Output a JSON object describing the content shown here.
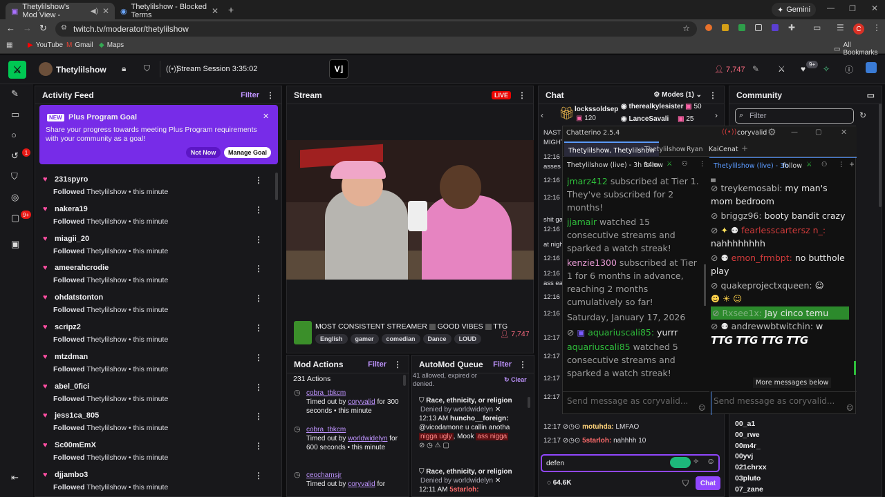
{
  "browser": {
    "tabs": [
      {
        "title": "Thetylilshow's Mod View -",
        "active": true
      },
      {
        "title": "Thetylilshow - Blocked Terms",
        "active": false
      }
    ],
    "url": "twitch.tv/moderator/thetylilshow",
    "gemini": "Gemini",
    "bookmarks": [
      "YouTube",
      "Gmail",
      "Maps"
    ],
    "all_bookmarks": "All Bookmarks",
    "profile_initial": "C"
  },
  "topnav": {
    "channel": "Thetylilshow",
    "session": "Stream Session 3:35:02",
    "viewers": "7,747",
    "notif_badge": "9+"
  },
  "rail": {
    "badge1": "1",
    "badge2": "9+"
  },
  "activity": {
    "title": "Activity Feed",
    "filter": "Filter",
    "promo": {
      "badge": "NEW",
      "title": "Plus Program Goal",
      "text": "Share your progress towards meeting Plus Program requirements with your community as a goal!",
      "not_now": "Not Now",
      "manage": "Manage Goal"
    },
    "items": [
      {
        "name": "231spyro",
        "action": "Followed",
        "target": "Thetylilshow",
        "time": "this minute"
      },
      {
        "name": "nakera19",
        "action": "Followed",
        "target": "Thetylilshow",
        "time": "this minute"
      },
      {
        "name": "miagii_20",
        "action": "Followed",
        "target": "Thetylilshow",
        "time": "this minute"
      },
      {
        "name": "ameerahcrodie",
        "action": "Followed",
        "target": "Thetylilshow",
        "time": "this minute"
      },
      {
        "name": "ohdatstonton",
        "action": "Followed",
        "target": "Thetylilshow",
        "time": "this minute"
      },
      {
        "name": "scripz2",
        "action": "Followed",
        "target": "Thetylilshow",
        "time": "this minute"
      },
      {
        "name": "mtzdman",
        "action": "Followed",
        "target": "Thetylilshow",
        "time": "this minute"
      },
      {
        "name": "abel_0fici",
        "action": "Followed",
        "target": "Thetylilshow",
        "time": "this minute"
      },
      {
        "name": "jess1ca_805",
        "action": "Followed",
        "target": "Thetylilshow",
        "time": "this minute"
      },
      {
        "name": "Sc00mEmX",
        "action": "Followed",
        "target": "Thetylilshow",
        "time": "this minute"
      },
      {
        "name": "djjambo3",
        "action": "Followed",
        "target": "Thetylilshow",
        "time": "this minute"
      }
    ]
  },
  "stream": {
    "title": "Stream",
    "live": "LIVE",
    "stream_title": "MOST CONSISTENT STREAMER",
    "good_vibes": "GOOD VIBES",
    "ttg": "TTG",
    "viewers": "7,747",
    "tags": [
      "English",
      "gamer",
      "comedian",
      "Dance",
      "LOUD"
    ]
  },
  "modactions": {
    "title": "Mod Actions",
    "filter": "Filter",
    "count": "231 Actions",
    "items": [
      {
        "user": "cobra_tbkcm",
        "text": "Timed out by",
        "mod": "coryvalid",
        "dur": "for 300 seconds",
        "time": "this minute"
      },
      {
        "user": "cobra_tbkcm",
        "text": "Timed out by",
        "mod": "worldwidelyn",
        "dur": "for 600 seconds",
        "time": "this minute"
      },
      {
        "user": "ceochamsjr",
        "text": "Timed out by",
        "mod": "coryvalid",
        "dur": "for"
      }
    ]
  },
  "automod": {
    "title": "AutoMod Queue",
    "filter": "Filter",
    "status": "41 allowed, expired or denied.",
    "clear": "Clear",
    "items": [
      {
        "category": "Race, ethnicity, or religion",
        "denied": "Denied by worldwidelyn",
        "time": "12:13 AM",
        "user": "huncho__foreign:",
        "msg1": "@vicodamone u callin anotha",
        "flag1": "nigga ugly",
        "msg2": ", Mook",
        "flag2": "ass nigga"
      },
      {
        "category": "Race, ethnicity, or religion",
        "denied": "Denied by worldwidelyn",
        "time": "12:11 AM",
        "user": "5starloh:"
      }
    ]
  },
  "chat": {
    "title": "Chat",
    "modes": "Modes (1)",
    "gifters": [
      {
        "name": "lockssoldsep",
        "count": "120"
      },
      {
        "name": "therealkylesister",
        "count": "50"
      },
      {
        "name": "LanceSavali",
        "count": "25"
      }
    ],
    "behind_lines": [
      {
        "time": "",
        "text": "NAST"
      },
      {
        "time": "",
        "text": "MIGHT"
      },
      {
        "time": "12:16",
        "text": ""
      },
      {
        "time": "",
        "text": "asses"
      },
      {
        "time": "12:16",
        "text": ""
      },
      {
        "time": "12:16",
        "text": ""
      },
      {
        "time": "",
        "text": "shit ga"
      },
      {
        "time": "12:16",
        "text": ""
      },
      {
        "time": "",
        "text": "at nigh"
      },
      {
        "time": "12:16",
        "text": ""
      },
      {
        "time": "12:16",
        "text": ""
      },
      {
        "time": "",
        "text": "ass ea"
      },
      {
        "time": "12:16",
        "text": ""
      },
      {
        "time": "12:16",
        "text": ""
      },
      {
        "time": "12:17",
        "text": ""
      },
      {
        "time": "12:17",
        "text": ""
      },
      {
        "time": "12:17",
        "text": ""
      },
      {
        "time": "12:17",
        "text": ""
      }
    ],
    "last_lines": [
      {
        "time": "12:17",
        "user": "motuhda:",
        "msg": "LMFAO",
        "color": "#ffd37a"
      },
      {
        "time": "12:17",
        "user": "5starloh:",
        "msg": "nahhhh 10",
        "color": "#ff6b6b"
      }
    ],
    "input": "defen",
    "points": "64.6K",
    "chat_button": "Chat"
  },
  "community": {
    "title": "Community",
    "filter_placeholder": "Filter",
    "users": [
      "00_a1",
      "00_rwe",
      "00m4r_",
      "00yvj",
      "021chrxx",
      "03pluto",
      "07_zane"
    ]
  },
  "chatterino": {
    "title": "Chatterino 2.5.4",
    "account": "coryvalid",
    "tabs": [
      "Thetylilshow, Thetylilshow",
      "Thetylilshow",
      "Ryan",
      "KaiCenat"
    ],
    "left_header": "Thetylilshow (live) - 3h 34m",
    "right_header": "Thetylilshow (live) - 3h",
    "follow": "follow",
    "left_messages": [
      {
        "user": "jmarz412",
        "text": " subscribed at Tier 1. They've subscribed for 2 months!"
      },
      {
        "user": "jjamair",
        "text": " watched 15 consecutive streams and sparked a watch streak!"
      },
      {
        "user": "kenzie1300",
        "text": " subscribed at Tier 1 for 6 months in advance, reaching 2 months cumulatively so far!"
      },
      {
        "date": "Saturday, January 17, 2026"
      },
      {
        "user": "aquariuscali85:",
        "text": " yurrr",
        "chat": true
      },
      {
        "user": "aquariuscali85",
        "text": " watched 5 consecutive streams and sparked a watch streak!"
      }
    ],
    "right_messages": [
      {
        "user": "treykemosabi:",
        "text": " my man's mom bedroom",
        "color": "#b9b9b9"
      },
      {
        "user": "briggz96:",
        "text": " booty bandit crazy",
        "color": "#b9b9b9"
      },
      {
        "user": "fearlesscartersz n_:",
        "text": " nahhhhhhhh",
        "color": "#d33b3b"
      },
      {
        "user": "emon_frmbpt:",
        "text": " no butthole play",
        "color": "#d33b3b"
      },
      {
        "user": "quakeprojectxqueen:",
        "text": "",
        "color": "#b9b9b9"
      },
      {
        "user": "Rxsee1x:",
        "text": " Jay cinco temu",
        "color": "#7fb27f",
        "highlight": true
      },
      {
        "user": "andrewwbtwitchin:",
        "text": " w",
        "color": "#b9b9b9"
      }
    ],
    "ttg_emotes": "TTG TTG TTG TTG",
    "more_messages": "More messages below",
    "send_placeholder": "Send message as coryvalid..."
  }
}
